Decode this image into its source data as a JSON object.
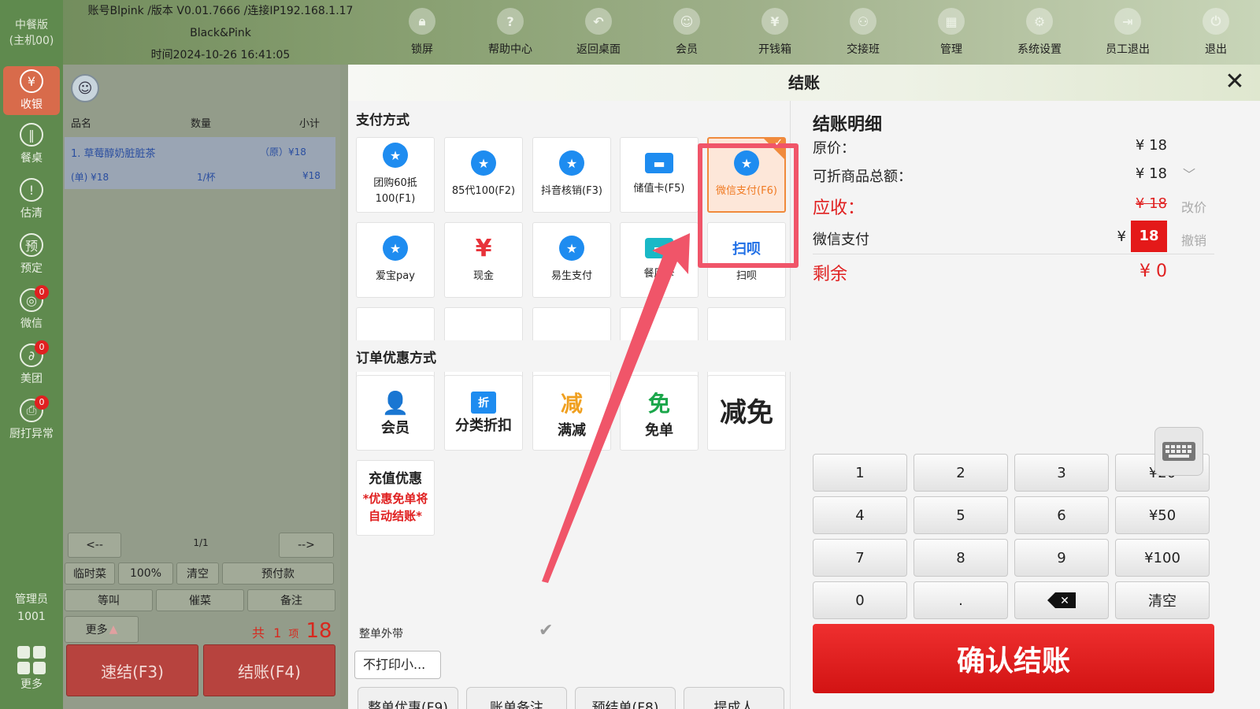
{
  "brand": {
    "line1": "中餐版",
    "line2": "(主机00)"
  },
  "info": {
    "account": "账号Blpink /版本 V0.01.7666 /连接IP192.168.1.17",
    "store": "Black&Pink",
    "time": "时间2024-10-26 16:41:05"
  },
  "topnav": [
    "锁屏",
    "帮助中心",
    "返回桌面",
    "会员",
    "开钱箱",
    "交接班",
    "管理",
    "系统设置",
    "员工退出",
    "退出"
  ],
  "sidebar": {
    "items": [
      {
        "label": "收银",
        "glyph": "¥"
      },
      {
        "label": "餐桌",
        "glyph": "‖"
      },
      {
        "label": "估清",
        "glyph": "!"
      },
      {
        "label": "预定",
        "glyph": "预"
      },
      {
        "label": "微信",
        "glyph": "◎",
        "badge": "0"
      },
      {
        "label": "美团",
        "glyph": "∂",
        "badge": "0"
      },
      {
        "label": "厨打异常",
        "glyph": "⎙",
        "badge": "0"
      }
    ],
    "admin_label": "管理员",
    "admin_id": "1001",
    "more_label": "更多"
  },
  "order": {
    "headers": {
      "name": "品名",
      "qty": "数量",
      "subtotal": "小计"
    },
    "item": {
      "name": "1. 草莓醇奶脏脏茶",
      "orig_price": "（原）¥18",
      "unit_price": "(单) ¥18",
      "qty": "1/杯",
      "subtotal": "¥18"
    },
    "prev": "<--",
    "page": "1/1",
    "next": "-->",
    "row1": [
      "临时菜",
      "100%",
      "清空",
      "预付款"
    ],
    "row2": [
      "等叫",
      "催菜",
      "备注"
    ],
    "more": "更多",
    "total_prefix": "共",
    "total_items": "1",
    "total_mid": "项",
    "total_amount": "18",
    "quick_pay": "速结(F3)",
    "checkout": "结账(F4)"
  },
  "modal": {
    "title": "结账",
    "close": "✕",
    "pay_section": "支付方式",
    "pay_methods": [
      {
        "label": "团购60抵100(F1)",
        "icon": "star-icon"
      },
      {
        "label": "85代100(F2)",
        "icon": "star-icon"
      },
      {
        "label": "抖音核销(F3)",
        "icon": "star-icon"
      },
      {
        "label": "储值卡(F5)",
        "icon": "card-icon"
      },
      {
        "label": "微信支付(F6)",
        "icon": "star-icon",
        "selected": true
      },
      {
        "label": "爱宝pay",
        "icon": "star-icon"
      },
      {
        "label": "现金",
        "icon": "yen-icon",
        "glyph": "¥"
      },
      {
        "label": "易生支付",
        "icon": "star-icon"
      },
      {
        "label": "餐厅卡",
        "icon": "card-icon"
      },
      {
        "label": "扫呗",
        "icon": "saobei-logo",
        "glyph": "扫呗"
      }
    ],
    "discount_section": "订单优惠方式",
    "discounts": [
      {
        "label": "会员",
        "glyph": "👤"
      },
      {
        "label": "分类折扣",
        "glyph": "折"
      },
      {
        "label": "满减",
        "glyph": "减"
      },
      {
        "label": "免单",
        "glyph": "免"
      },
      {
        "label": "减免",
        "glyph": ""
      }
    ],
    "recharge": {
      "title": "充值优惠",
      "note": "*优惠免单将自动结账*"
    },
    "takeaway_label": "整单外带",
    "no_print": "不打印小...",
    "footer_buttons": [
      "整单优惠(F9)",
      "账单备注",
      "预结单(F8)",
      "提成人"
    ],
    "detail": {
      "title": "结账明细",
      "orig_label": "原价：",
      "orig_value": "¥ 18",
      "discountable_label": "可折商品总额：",
      "discountable_value": "¥ 18",
      "receivable_label": "应收：",
      "receivable_value": "¥ 18",
      "change_price": "改价",
      "wechat_label": "微信支付",
      "wechat_currency": "¥",
      "wechat_value": "18",
      "cancel": "撤销",
      "remaining_label": "剩余",
      "remaining_value": "¥ 0"
    },
    "keypad": [
      "1",
      "2",
      "3",
      "¥20",
      "4",
      "5",
      "6",
      "¥50",
      "7",
      "8",
      "9",
      "¥100",
      "0",
      ".",
      "",
      "清空"
    ],
    "confirm": "确认结账"
  },
  "colors": {
    "accent_red": "#e02020",
    "selected_orange": "#f08a3c",
    "sidebar_green": "#5f8a4e",
    "highlight_pink": "#f05569",
    "pay_blue": "#1e8cf0"
  }
}
